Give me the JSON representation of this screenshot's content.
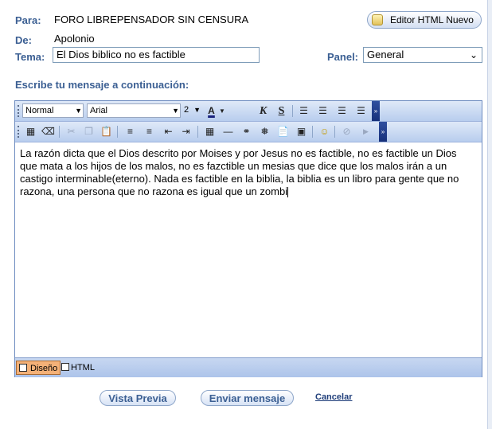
{
  "header": {
    "to_label": "Para:",
    "to_value": "FORO LIBREPENSADOR SIN CENSURA",
    "from_label": "De:",
    "from_value": "Apolonio",
    "subject_label": "Tema:",
    "subject_value": "El Dios biblico no es factible",
    "panel_label": "Panel:",
    "panel_value": "General",
    "editor_html_button": "Editor HTML Nuevo"
  },
  "prompt": "Escribe tu mensaje a continuación:",
  "toolbar": {
    "format_value": "Normal",
    "font_value": "Arial",
    "size_value": "2",
    "bold_label": "K",
    "underline_label": "S"
  },
  "message": "La razón dicta que el Dios descrito por Moises y por Jesus no es factible, no es factible un Dios que  mata a los hijos de los malos, no es fazctible un mesias que dice que los malos irán a un castigo interminable(eterno). Nada es factible en la biblia, la biblia es un libro para gente que no razona, una persona que no razona es igual que un zombi",
  "modes": {
    "design": "Diseño",
    "html": "HTML"
  },
  "actions": {
    "preview": "Vista Previa",
    "send": "Enviar mensaje",
    "cancel": "Cancelar"
  },
  "colors": {
    "label_blue": "#3b5f93",
    "toolbar_bg": "#c6d7f1",
    "active_tab": "#f4b178"
  }
}
